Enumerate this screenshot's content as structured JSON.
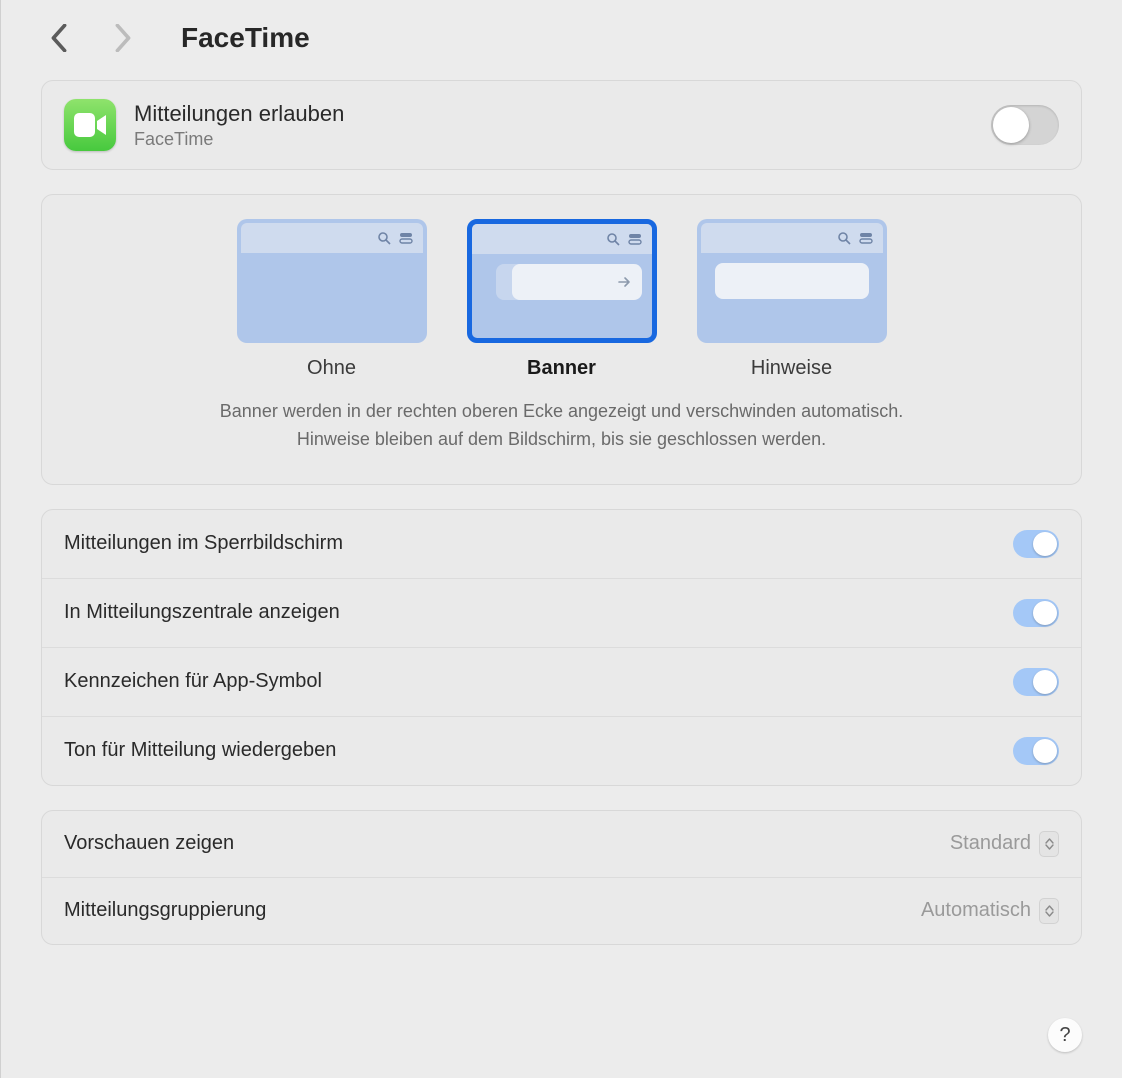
{
  "header": {
    "title": "FaceTime"
  },
  "allow": {
    "title": "Mitteilungen erlauben",
    "subtitle": "FaceTime",
    "enabled": false
  },
  "alert_styles": {
    "options": [
      {
        "id": "none",
        "label": "Ohne",
        "selected": false
      },
      {
        "id": "banner",
        "label": "Banner",
        "selected": true
      },
      {
        "id": "alert",
        "label": "Hinweise",
        "selected": false
      }
    ],
    "description_line1": "Banner werden in der rechten oberen Ecke angezeigt und verschwinden automatisch.",
    "description_line2": "Hinweise bleiben auf dem Bildschirm, bis sie geschlossen werden."
  },
  "toggles": [
    {
      "id": "lockscreen",
      "label": "Mitteilungen im Sperrbildschirm",
      "on": true
    },
    {
      "id": "center",
      "label": "In Mitteilungszentrale anzeigen",
      "on": true
    },
    {
      "id": "badge",
      "label": "Kennzeichen für App-Symbol",
      "on": true
    },
    {
      "id": "sound",
      "label": "Ton für Mitteilung wiedergeben",
      "on": true
    }
  ],
  "selects": [
    {
      "id": "previews",
      "label": "Vorschauen zeigen",
      "value": "Standard"
    },
    {
      "id": "grouping",
      "label": "Mitteilungsgruppierung",
      "value": "Automatisch"
    }
  ],
  "help": "?"
}
